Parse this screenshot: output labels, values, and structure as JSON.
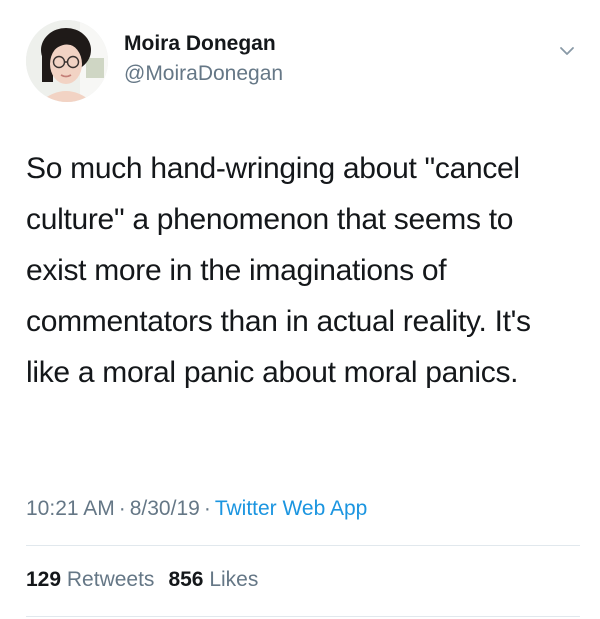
{
  "author": {
    "name": "Moira Donegan",
    "handle": "@MoiraDonegan",
    "avatar": "avatar-photo"
  },
  "tweet": {
    "text": "So much hand-wringing about \"cancel culture\" a phenomenon that seems to exist more in the imaginations of commentators than in actual reality. It's like a moral panic about moral panics."
  },
  "meta": {
    "time": "10:21 AM",
    "date": "8/30/19",
    "source": "Twitter Web App",
    "separator": "·"
  },
  "stats": {
    "retweets_count": "129",
    "retweets_label": "Retweets",
    "likes_count": "856",
    "likes_label": "Likes"
  },
  "icons": {
    "caret": "chevron-down-icon"
  },
  "colors": {
    "text": "#14171a",
    "secondary": "#657786",
    "link": "#1b95e0",
    "divider": "#e1e8ed"
  }
}
